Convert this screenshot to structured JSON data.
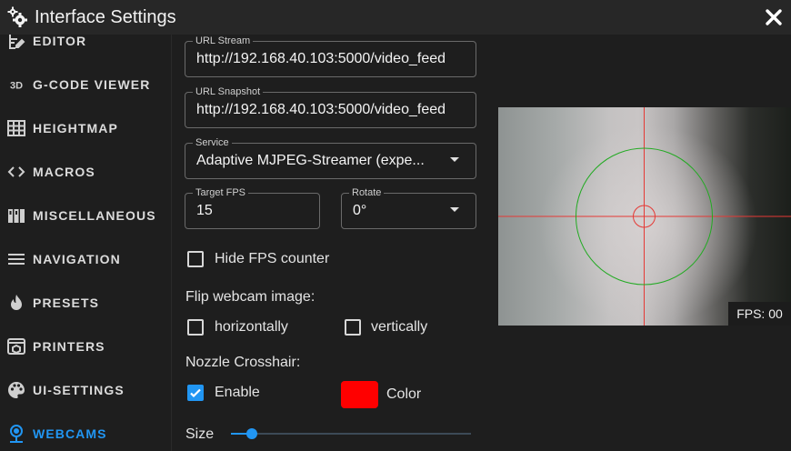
{
  "window": {
    "title": "Interface Settings"
  },
  "sidebar": {
    "items": [
      {
        "label": "EDITOR",
        "icon": "file-edit-icon"
      },
      {
        "label": "G-CODE VIEWER",
        "icon": "3d-icon"
      },
      {
        "label": "HEIGHTMAP",
        "icon": "grid-icon"
      },
      {
        "label": "MACROS",
        "icon": "code-brackets-icon"
      },
      {
        "label": "MISCELLANEOUS",
        "icon": "widgets-icon"
      },
      {
        "label": "NAVIGATION",
        "icon": "menu-icon"
      },
      {
        "label": "PRESETS",
        "icon": "fire-icon"
      },
      {
        "label": "PRINTERS",
        "icon": "printer-3d-icon"
      },
      {
        "label": "UI-SETTINGS",
        "icon": "palette-icon"
      },
      {
        "label": "WEBCAMS",
        "icon": "webcam-icon",
        "active": true
      }
    ],
    "active_color": "#2196f3"
  },
  "form": {
    "url_stream": {
      "label": "URL Stream",
      "value": "http://192.168.40.103:5000/video_feed"
    },
    "url_snapshot": {
      "label": "URL Snapshot",
      "value": "http://192.168.40.103:5000/video_feed"
    },
    "service": {
      "label": "Service",
      "value": "Adaptive MJPEG-Streamer (expe..."
    },
    "target_fps": {
      "label": "Target FPS",
      "value": "15"
    },
    "rotate": {
      "label": "Rotate",
      "value": "0°"
    },
    "hide_fps": {
      "label": "Hide FPS counter",
      "checked": false
    },
    "flip_heading": "Flip webcam image:",
    "flip_horizontal": {
      "label": "horizontally",
      "checked": false
    },
    "flip_vertical": {
      "label": "vertically",
      "checked": false
    },
    "crosshair_heading": "Nozzle Crosshair:",
    "crosshair_enable": {
      "label": "Enable",
      "checked": true
    },
    "crosshair_color": {
      "label": "Color",
      "value": "#ff0000"
    },
    "size": {
      "label": "Size",
      "value_fraction": 0.09
    }
  },
  "preview": {
    "fps_text": "FPS: 00",
    "crosshair_color": "#e53935",
    "circle_color": "#22aa22"
  }
}
